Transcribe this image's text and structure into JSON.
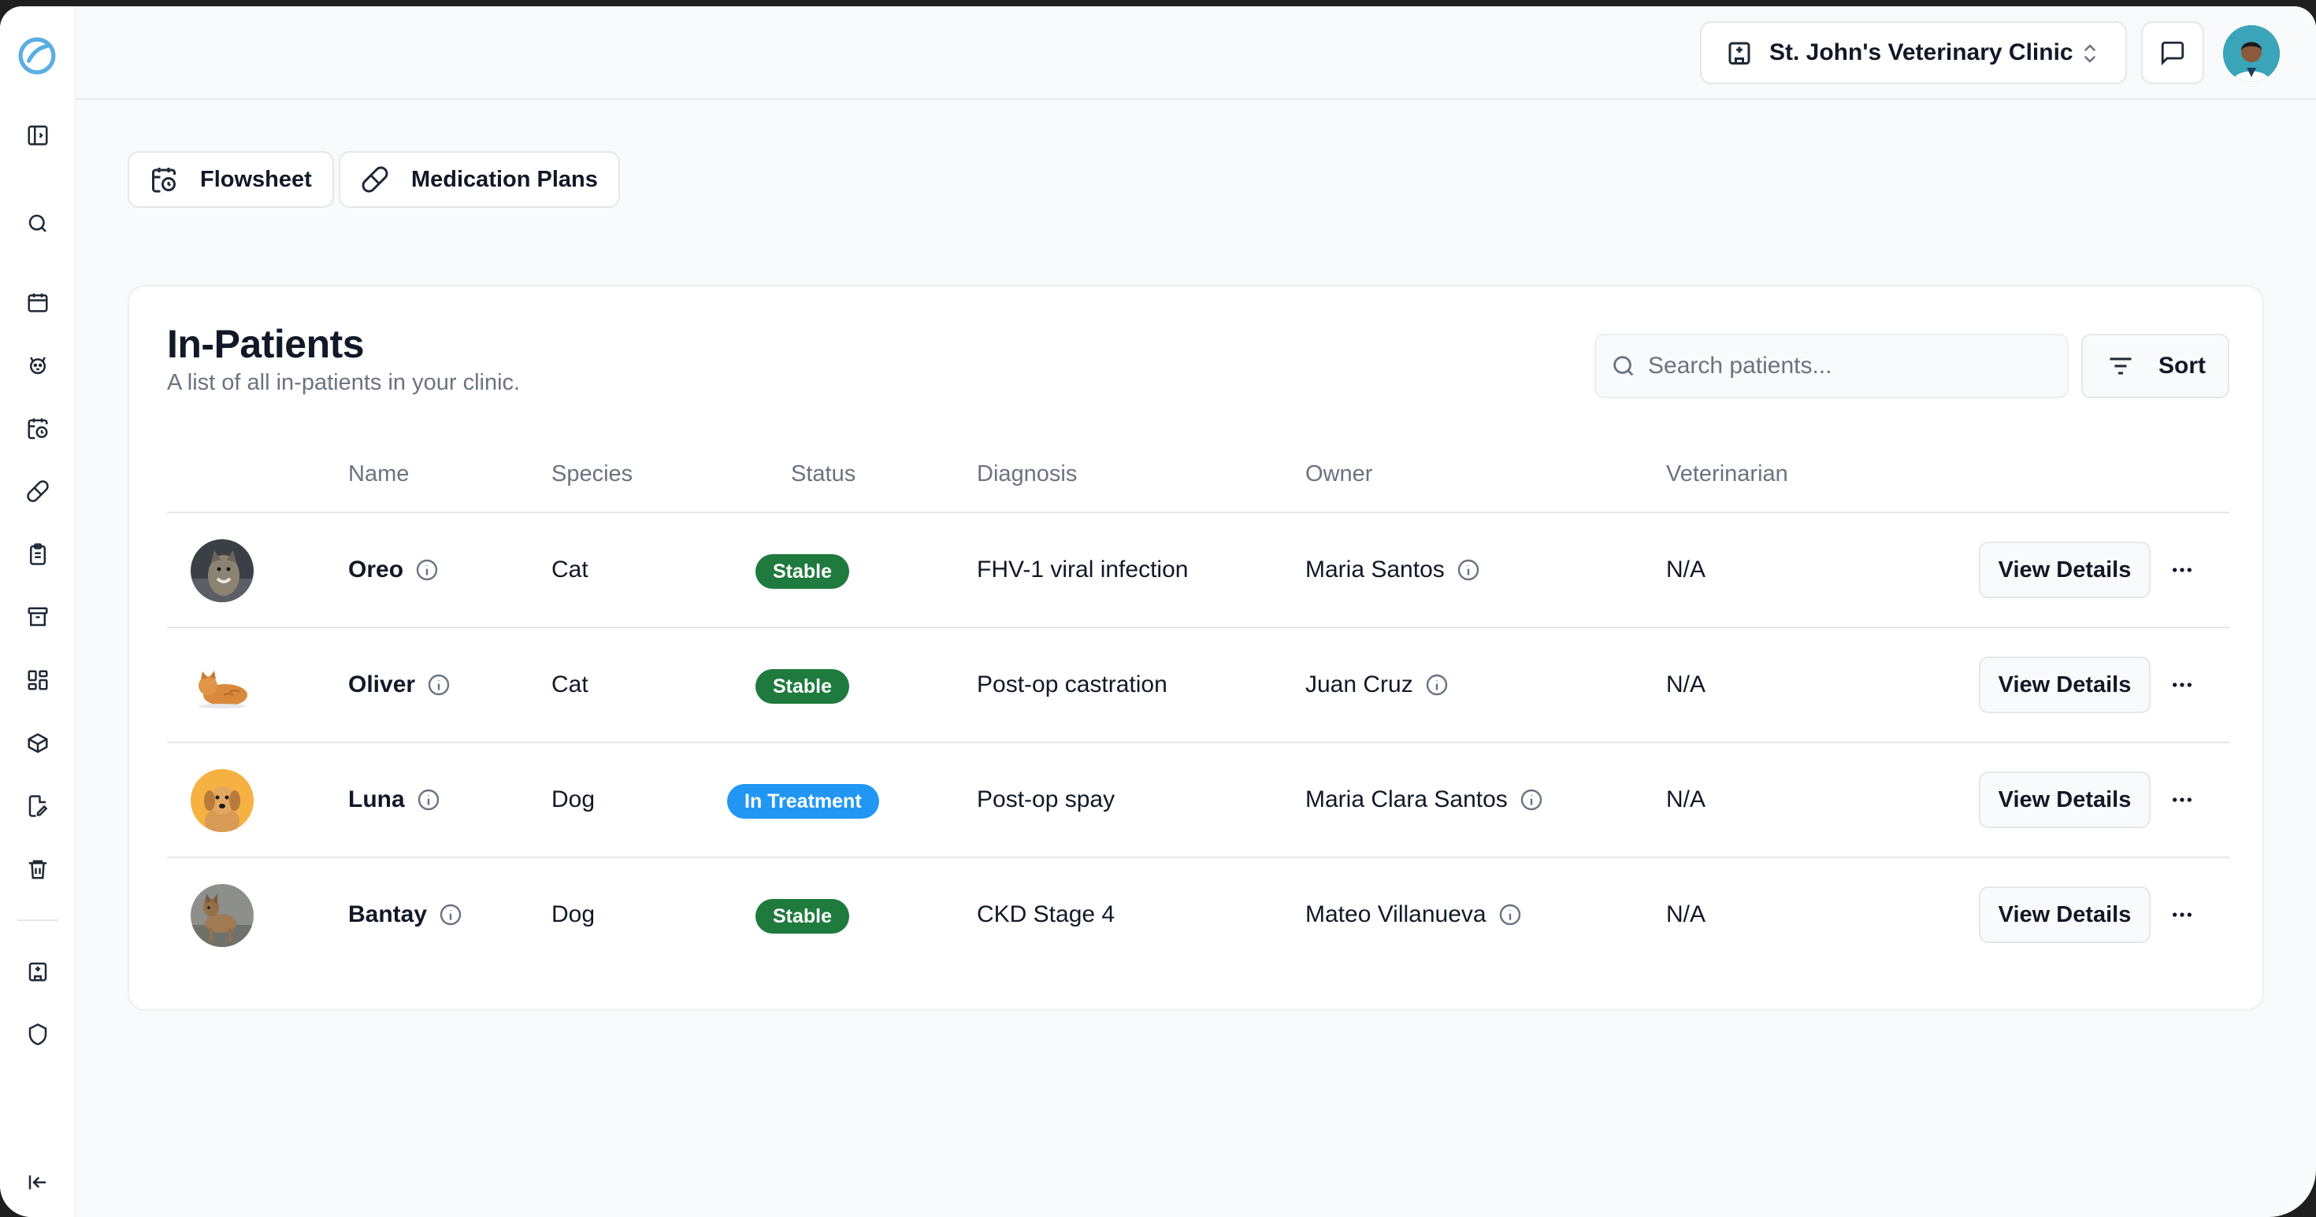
{
  "header": {
    "clinic_name": "St. John's Veterinary Clinic"
  },
  "tabs": [
    {
      "label": "Flowsheet",
      "icon": "calendar-clock-icon"
    },
    {
      "label": "Medication Plans",
      "icon": "pill-icon"
    }
  ],
  "sidebar": {
    "items": [
      "logo-icon",
      "panel-toggle-icon",
      "search-icon",
      "calendar-icon",
      "paw-icon",
      "calendar-clock-icon",
      "pill-icon",
      "clipboard-icon",
      "archive-icon",
      "dashboard-icon",
      "package-icon",
      "file-edit-icon",
      "trash-icon",
      "hospital-icon",
      "shield-icon",
      "collapse-icon"
    ]
  },
  "card": {
    "title": "In-Patients",
    "subtitle": "A list of all in-patients in your clinic.",
    "search_placeholder": "Search patients...",
    "sort_label": "Sort"
  },
  "table": {
    "columns": [
      "Name",
      "Species",
      "Status",
      "Diagnosis",
      "Owner",
      "Veterinarian"
    ],
    "rows": [
      {
        "name": "Oreo",
        "species": "Cat",
        "status": "Stable",
        "diagnosis": "FHV-1 viral infection",
        "owner": "Maria Santos",
        "vet": "N/A",
        "action": "View Details"
      },
      {
        "name": "Oliver",
        "species": "Cat",
        "status": "Stable",
        "diagnosis": "Post-op castration",
        "owner": "Juan Cruz",
        "vet": "N/A",
        "action": "View Details"
      },
      {
        "name": "Luna",
        "species": "Dog",
        "status": "In Treatment",
        "diagnosis": "Post-op spay",
        "owner": "Maria Clara Santos",
        "vet": "N/A",
        "action": "View Details"
      },
      {
        "name": "Bantay",
        "species": "Dog",
        "status": "Stable",
        "diagnosis": "CKD Stage 4",
        "owner": "Mateo Villanueva",
        "vet": "N/A",
        "action": "View Details"
      }
    ]
  },
  "colors": {
    "stable": "#1f7a3d",
    "in_treatment": "#2196f3",
    "brand": "#4aa3df"
  }
}
